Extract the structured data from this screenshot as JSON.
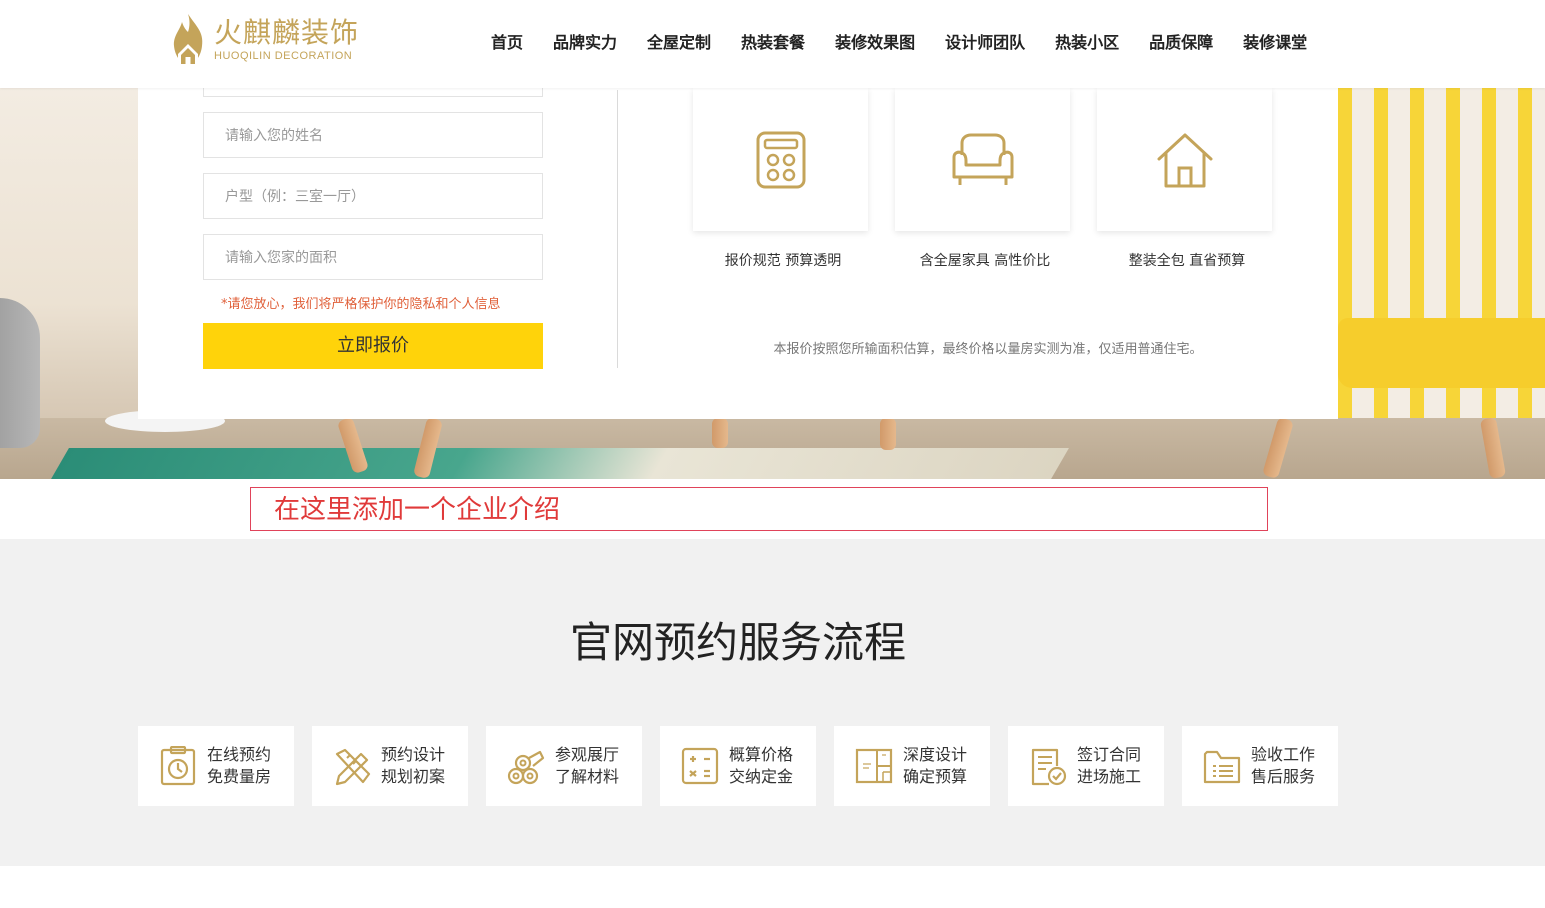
{
  "brand": {
    "name_cn": "火麒麟装饰",
    "name_en": "HUOQILIN DECORATION",
    "accent_color": "#c4a45a"
  },
  "nav": {
    "items": [
      "首页",
      "品牌实力",
      "全屋定制",
      "热装套餐",
      "装修效果图",
      "设计师团队",
      "热装小区",
      "品质保障",
      "装修课堂"
    ]
  },
  "form": {
    "name_placeholder": "请输入您的姓名",
    "layout_placeholder": "户型（例：三室一厅）",
    "area_placeholder": "请输入您家的面积",
    "privacy_note": "*请您放心，我们将严格保护你的隐私和个人信息",
    "submit_label": "立即报价",
    "submit_color": "#ffd30a"
  },
  "features": [
    {
      "icon": "calculator-icon",
      "label": "报价规范 预算透明"
    },
    {
      "icon": "sofa-icon",
      "label": "含全屋家具 高性价比"
    },
    {
      "icon": "house-icon",
      "label": "整装全包 直省预算"
    }
  ],
  "quote_note": "本报价按照您所输面积估算，最终价格以量房实测为准，仅适用普通住宅。",
  "intro_annotation": "在这里添加一个企业介绍",
  "process": {
    "title": "官网预约服务流程",
    "steps": [
      {
        "icon": "clock-icon",
        "line1": "在线预约",
        "line2": "免费量房"
      },
      {
        "icon": "ruler-pencil-icon",
        "line1": "预约设计",
        "line2": "规划初案"
      },
      {
        "icon": "material-rolls-icon",
        "line1": "参观展厅",
        "line2": "了解材料"
      },
      {
        "icon": "calculator-icon",
        "line1": "概算价格",
        "line2": "交纳定金"
      },
      {
        "icon": "floorplan-icon",
        "line1": "深度设计",
        "line2": "确定预算"
      },
      {
        "icon": "contract-check-icon",
        "line1": "签订合同",
        "line2": "进场施工"
      },
      {
        "icon": "folder-list-icon",
        "line1": "验收工作",
        "line2": "售后服务"
      }
    ]
  }
}
